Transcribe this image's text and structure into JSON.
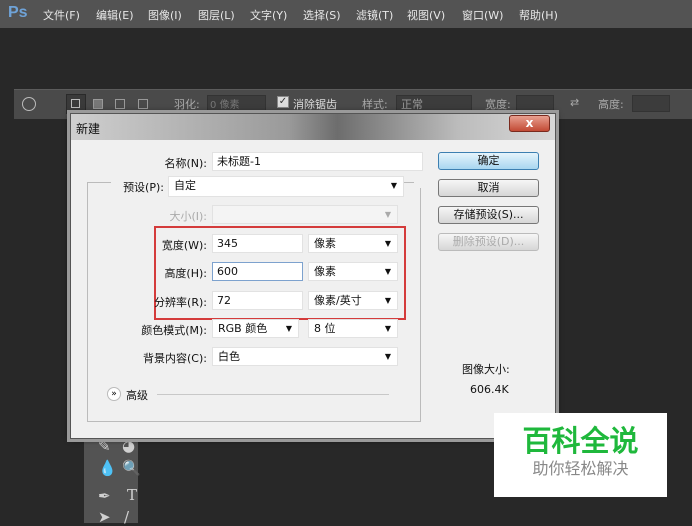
{
  "app": {
    "logo": "Ps"
  },
  "menu": [
    "文件(F)",
    "编辑(E)",
    "图像(I)",
    "图层(L)",
    "文字(Y)",
    "选择(S)",
    "滤镜(T)",
    "视图(V)",
    "窗口(W)",
    "帮助(H)"
  ],
  "options": {
    "feather_label": "羽化:",
    "feather_value": "0 像素",
    "antialias_label": "消除锯齿",
    "antialias_checked": true,
    "style_label": "样式:",
    "style_value": "正常",
    "width_label": "宽度:",
    "height_label": "高度:"
  },
  "dialog": {
    "title": "新建",
    "close": "x",
    "name_label": "名称(N):",
    "name_value": "未标题-1",
    "preset_label": "预设(P):",
    "preset_value": "自定",
    "size_label": "大小(I):",
    "width_label": "宽度(W):",
    "width_value": "345",
    "width_unit": "像素",
    "height_label": "高度(H):",
    "height_value": "600",
    "height_unit": "像素",
    "res_label": "分辨率(R):",
    "res_value": "72",
    "res_unit": "像素/英寸",
    "mode_label": "颜色模式(M):",
    "mode_value": "RGB 颜色",
    "depth_value": "8 位",
    "bg_label": "背景内容(C):",
    "bg_value": "白色",
    "advanced": "高级",
    "ok": "确定",
    "cancel": "取消",
    "save_preset": "存储预设(S)...",
    "delete_preset": "删除预设(D)...",
    "image_size_label": "图像大小:",
    "image_size_value": "606.4K"
  },
  "watermark": {
    "title": "百科全说",
    "subtitle": "助你轻松解决"
  },
  "colors": {
    "highlight": "#d43b3b",
    "watermark": "#1fb83c"
  }
}
